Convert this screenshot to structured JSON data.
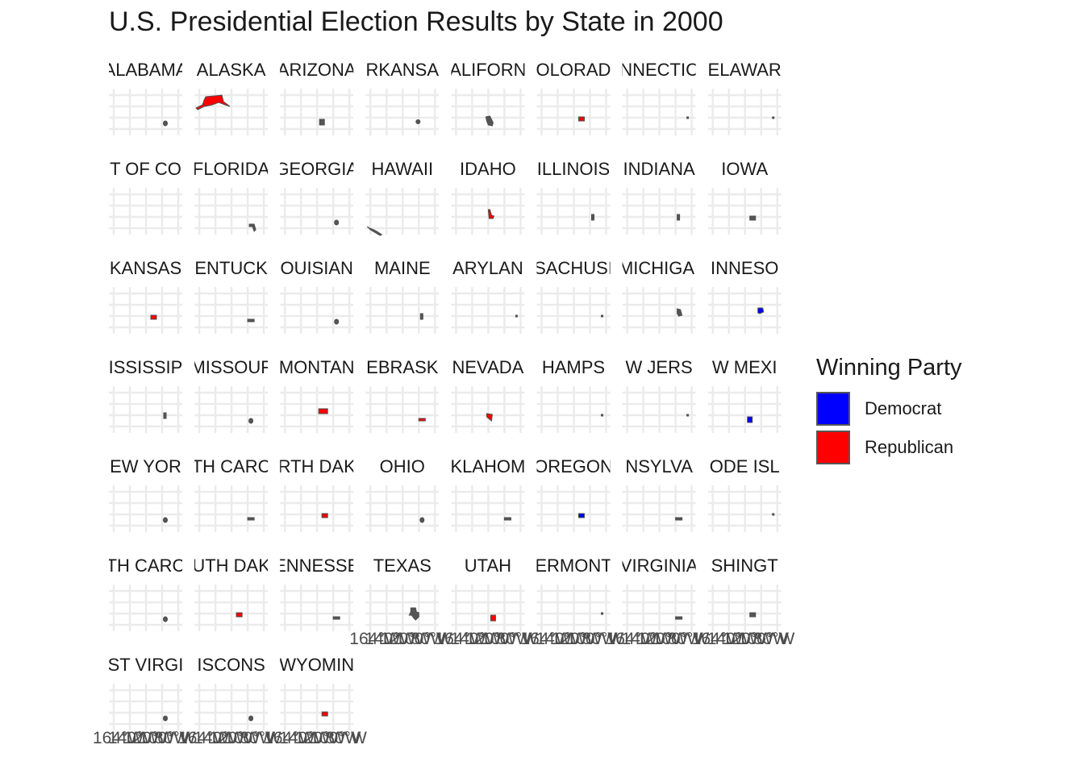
{
  "chart_data": {
    "type": "faceted-map",
    "title": "U.S. Presidential Election Results by State in 2000",
    "legend": {
      "title": "Winning Party",
      "placement": "right",
      "entries": [
        {
          "name": "Democrat",
          "color": "#0000ff"
        },
        {
          "name": "Republican",
          "color": "#ff0000"
        }
      ]
    },
    "facet_columns": 8,
    "facets": [
      {
        "label": "ALABAMA",
        "shown_label": "ALABAMA",
        "winner": "none",
        "shape": "blob"
      },
      {
        "label": "ALASKA",
        "shown_label": "ALASKA",
        "winner": "Republican",
        "shape": "alaska"
      },
      {
        "label": "ARIZONA",
        "shown_label": "ARIZONA",
        "winner": "none",
        "shape": "square"
      },
      {
        "label": "ARKANSAS",
        "shown_label": "RKANSA",
        "winner": "none",
        "shape": "dot"
      },
      {
        "label": "CALIFORNIA",
        "shown_label": "ALIFORN",
        "winner": "none",
        "shape": "california"
      },
      {
        "label": "COLORADO",
        "shown_label": "OLORAD",
        "winner": "Republican",
        "shape": "rect"
      },
      {
        "label": "CONNECTICUT",
        "shown_label": "NNECTIC",
        "winner": "none",
        "shape": "speck"
      },
      {
        "label": "DELAWARE",
        "shown_label": "ELAWAR",
        "winner": "none",
        "shape": "speck"
      },
      {
        "label": "DISTRICT OF COLUMBIA",
        "shown_label": "T OF CO",
        "winner": "none",
        "shape": "none"
      },
      {
        "label": "FLORIDA",
        "shown_label": "FLORIDA",
        "winner": "none",
        "shape": "florida"
      },
      {
        "label": "GEORGIA",
        "shown_label": "GEORGIA",
        "winner": "none",
        "shape": "blob"
      },
      {
        "label": "HAWAII",
        "shown_label": "HAWAII",
        "winner": "none",
        "shape": "hawaii"
      },
      {
        "label": "IDAHO",
        "shown_label": "IDAHO",
        "winner": "Republican",
        "shape": "idaho"
      },
      {
        "label": "ILLINOIS",
        "shown_label": "ILLINOIS",
        "winner": "none",
        "shape": "tall"
      },
      {
        "label": "INDIANA",
        "shown_label": "INDIANA",
        "winner": "none",
        "shape": "tall"
      },
      {
        "label": "IOWA",
        "shown_label": "IOWA",
        "winner": "none",
        "shape": "rect"
      },
      {
        "label": "KANSAS",
        "shown_label": "KANSAS",
        "winner": "Republican",
        "shape": "rect"
      },
      {
        "label": "KENTUCKY",
        "shown_label": "ENTUCK",
        "winner": "none",
        "shape": "wide"
      },
      {
        "label": "LOUISIANA",
        "shown_label": "OUISIAN",
        "winner": "none",
        "shape": "blob"
      },
      {
        "label": "MAINE",
        "shown_label": "MAINE",
        "winner": "none",
        "shape": "tall"
      },
      {
        "label": "MARYLAND",
        "shown_label": "ARYLAN",
        "winner": "none",
        "shape": "speck"
      },
      {
        "label": "MASSACHUSETTS",
        "shown_label": "SACHUSI",
        "winner": "none",
        "shape": "speck"
      },
      {
        "label": "MICHIGAN",
        "shown_label": "MICHIGAI",
        "winner": "none",
        "shape": "michigan"
      },
      {
        "label": "MINNESOTA",
        "shown_label": "INNESO",
        "winner": "Democrat",
        "shape": "minnesota"
      },
      {
        "label": "MISSISSIPPI",
        "shown_label": "ISSISSIP",
        "winner": "none",
        "shape": "tall"
      },
      {
        "label": "MISSOURI",
        "shown_label": "MISSOUF",
        "winner": "none",
        "shape": "blob"
      },
      {
        "label": "MONTANA",
        "shown_label": "MONTAN",
        "winner": "Republican",
        "shape": "montana"
      },
      {
        "label": "NEBRASKA",
        "shown_label": "EBRASK",
        "winner": "Republican",
        "shape": "wide"
      },
      {
        "label": "NEVADA",
        "shown_label": "NEVADA",
        "winner": "Republican",
        "shape": "nevada"
      },
      {
        "label": "NEW HAMPSHIRE",
        "shown_label": "HAMPS",
        "winner": "none",
        "shape": "speck"
      },
      {
        "label": "NEW JERSEY",
        "shown_label": "W JERS",
        "winner": "none",
        "shape": "speck"
      },
      {
        "label": "NEW MEXICO",
        "shown_label": "W MEXI",
        "winner": "Democrat",
        "shape": "square"
      },
      {
        "label": "NEW YORK",
        "shown_label": "EW YOR",
        "winner": "none",
        "shape": "blob"
      },
      {
        "label": "NORTH CAROLINA",
        "shown_label": "TH CARC",
        "winner": "none",
        "shape": "wide"
      },
      {
        "label": "NORTH DAKOTA",
        "shown_label": "RTH DAK",
        "winner": "Republican",
        "shape": "rect"
      },
      {
        "label": "OHIO",
        "shown_label": "OHIO",
        "winner": "none",
        "shape": "blob"
      },
      {
        "label": "OKLAHOMA",
        "shown_label": "KLAHOM",
        "winner": "none",
        "shape": "wide"
      },
      {
        "label": "OREGON",
        "shown_label": "OREGON",
        "winner": "Democrat",
        "shape": "rect"
      },
      {
        "label": "PENNSYLVANIA",
        "shown_label": "NSYLVA",
        "winner": "none",
        "shape": "wide"
      },
      {
        "label": "RHODE ISLAND",
        "shown_label": "ODE ISL",
        "winner": "none",
        "shape": "speck"
      },
      {
        "label": "SOUTH CAROLINA",
        "shown_label": "TH CARC",
        "winner": "none",
        "shape": "blob"
      },
      {
        "label": "SOUTH DAKOTA",
        "shown_label": "UTH DAK",
        "winner": "Republican",
        "shape": "rect"
      },
      {
        "label": "TENNESSEE",
        "shown_label": "ENNESSE",
        "winner": "none",
        "shape": "wide"
      },
      {
        "label": "TEXAS",
        "shown_label": "TEXAS",
        "winner": "none",
        "shape": "texas"
      },
      {
        "label": "UTAH",
        "shown_label": "UTAH",
        "winner": "Republican",
        "shape": "square"
      },
      {
        "label": "VERMONT",
        "shown_label": "ERMONT",
        "winner": "none",
        "shape": "speck"
      },
      {
        "label": "VIRGINIA",
        "shown_label": "VIRGINIA",
        "winner": "none",
        "shape": "wide"
      },
      {
        "label": "WASHINGTON",
        "shown_label": "SHINGT",
        "winner": "none",
        "shape": "rect"
      },
      {
        "label": "WEST VIRGINIA",
        "shown_label": "ST VIRGI",
        "winner": "none",
        "shape": "blob"
      },
      {
        "label": "WISCONSIN",
        "shown_label": "ISCONS",
        "winner": "none",
        "shape": "blob"
      },
      {
        "label": "WYOMING",
        "shown_label": "WYOMIN",
        "winner": "Republican",
        "shape": "rect"
      }
    ],
    "x_tick_labels": [
      "164°W",
      "140°W",
      "120°W",
      "100°W",
      "80°W"
    ],
    "grid": true,
    "colors": {
      "outline": "#4d4d4d",
      "no_data_fill": "#555555",
      "grid": "#ebebeb"
    }
  }
}
